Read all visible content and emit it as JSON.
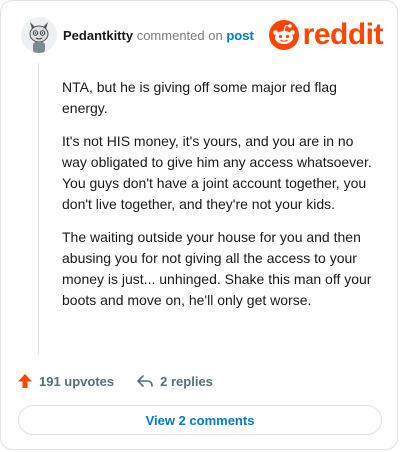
{
  "comment": {
    "username": "Pedantkitty",
    "commented_text": "commented on",
    "post_link": "post",
    "paragraphs": [
      "NTA, but he is giving off some major red flag energy.",
      "It's not HIS money, it's yours, and you are in no way obligated to give him any access whatsoever. You guys don't have a joint account together, you don't live together, and they're not your kids.",
      "The waiting outside your house for you and then abusing you for not giving all the access to your money is just... unhinged. Shake this man off your boots and move on, he'll only get worse."
    ]
  },
  "brand": {
    "name": "reddit",
    "color": "#ff4500"
  },
  "actions": {
    "upvotes_label": "191 upvotes",
    "replies_label": "2 replies",
    "upvote_color": "#ff4500"
  },
  "view_comments_label": "View 2 comments",
  "icons": {
    "avatar": "avatar-icon",
    "upvote": "upvote-arrow-icon",
    "reply": "reply-arrow-icon",
    "logo": "reddit-snoo-icon"
  }
}
